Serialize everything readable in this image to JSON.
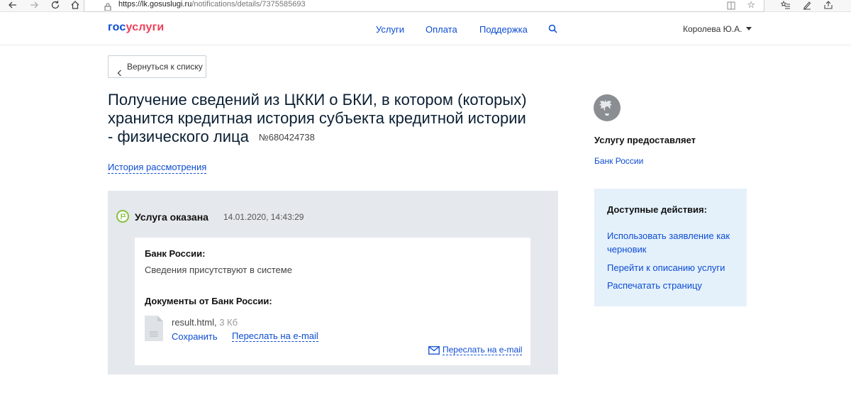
{
  "browser": {
    "url_host": "https://lk.gosuslugi.ru",
    "url_path": "/notifications/details/7375585693"
  },
  "header": {
    "logo_part1": "гос",
    "logo_part2": "услуги",
    "nav": [
      "Услуги",
      "Оплата",
      "Поддержка"
    ],
    "user_name": "Королева Ю.А."
  },
  "page": {
    "back_label": "Вернуться к списку",
    "title": "Получение сведений из ЦККИ о БКИ, в котором (которых) хранится кредитная история субъекта кредитной истории - физического лица",
    "number": "№680424738",
    "history_link": "История рассмотрения"
  },
  "status": {
    "title": "Услуга оказана",
    "date": "14.01.2020, 14:43:29",
    "org_label": "Банк России:",
    "org_message": "Сведения присутствуют в системе",
    "docs_label": "Документы от Банк России:",
    "file_name": "result.html,",
    "file_size": "3 Кб",
    "save_label": "Сохранить",
    "forward_label": "Переслать на e-mail",
    "forward_label_2": "Переслать на e-mail"
  },
  "sidebar": {
    "provides_label": "Услугу предоставляет",
    "provider": "Банк России",
    "actions_title": "Доступные действия:",
    "actions": [
      "Использовать заявление как черновик",
      "Перейти к описанию услуги",
      "Распечатать страницу"
    ]
  },
  "colors": {
    "link": "#0d4cd3",
    "logo_red": "#ee3f58",
    "status_green": "#88c040",
    "panel_gray": "#e5e8ec",
    "actions_blue": "#e4f1fb"
  }
}
